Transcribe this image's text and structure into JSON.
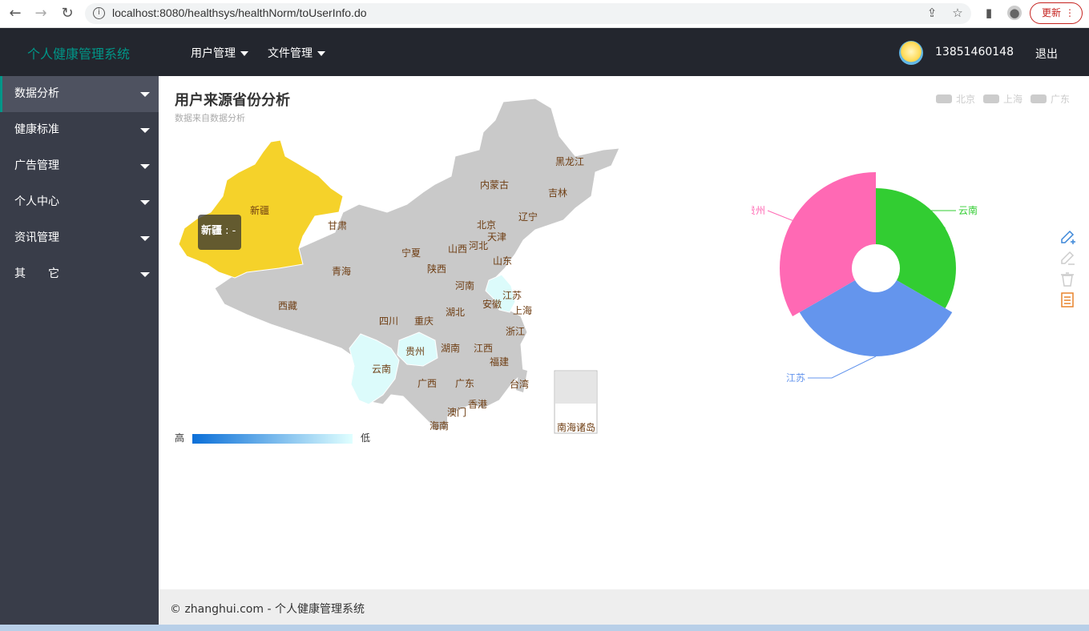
{
  "browser": {
    "url": "localhost:8080/healthsys/healthNorm/toUserInfo.do",
    "update_label": "更新"
  },
  "header": {
    "logo": "个人健康管理系统",
    "nav": [
      "用户管理",
      "文件管理"
    ],
    "phone": "13851460148",
    "logout": "退出"
  },
  "sidebar": {
    "items": [
      "数据分析",
      "健康标准",
      "广告管理",
      "个人中心",
      "资讯管理",
      "其　　它"
    ],
    "active_index": 0
  },
  "main": {
    "title": "用户来源省份分析",
    "subtitle": "数据来自数据分析",
    "legend": [
      "北京",
      "上海",
      "广东"
    ],
    "visual_map": {
      "high": "高",
      "low": "低"
    },
    "tooltip": {
      "name": "新疆",
      "value": " : -"
    },
    "map_labels": [
      "黑龙江",
      "吉林",
      "辽宁",
      "内蒙古",
      "北京",
      "天津",
      "河北",
      "山西",
      "山东",
      "宁夏",
      "甘肃",
      "新疆",
      "青海",
      "陕西",
      "河南",
      "江苏",
      "安徽",
      "上海",
      "湖北",
      "西藏",
      "四川",
      "重庆",
      "浙江",
      "湖南",
      "江西",
      "贵州",
      "云南",
      "福建",
      "广西",
      "广东",
      "台湾",
      "香港",
      "澳门",
      "海南",
      "南海诸岛"
    ],
    "pie_labels": [
      "云南",
      "江苏",
      "贵州"
    ]
  },
  "chart_data": [
    {
      "type": "map",
      "title": "用户来源省份分析",
      "subtitle": "数据来自数据分析",
      "highlighted": [
        "新疆"
      ],
      "light": [
        "江苏",
        "贵州",
        "云南"
      ]
    },
    {
      "type": "pie",
      "categories": [
        "云南",
        "江苏",
        "贵州"
      ],
      "values": [
        1,
        1,
        1
      ],
      "colors": [
        "#32cd32",
        "#6495ed",
        "#ff69b4"
      ]
    }
  ],
  "footer": {
    "text": "© zhanghui.com - 个人健康管理系统"
  }
}
